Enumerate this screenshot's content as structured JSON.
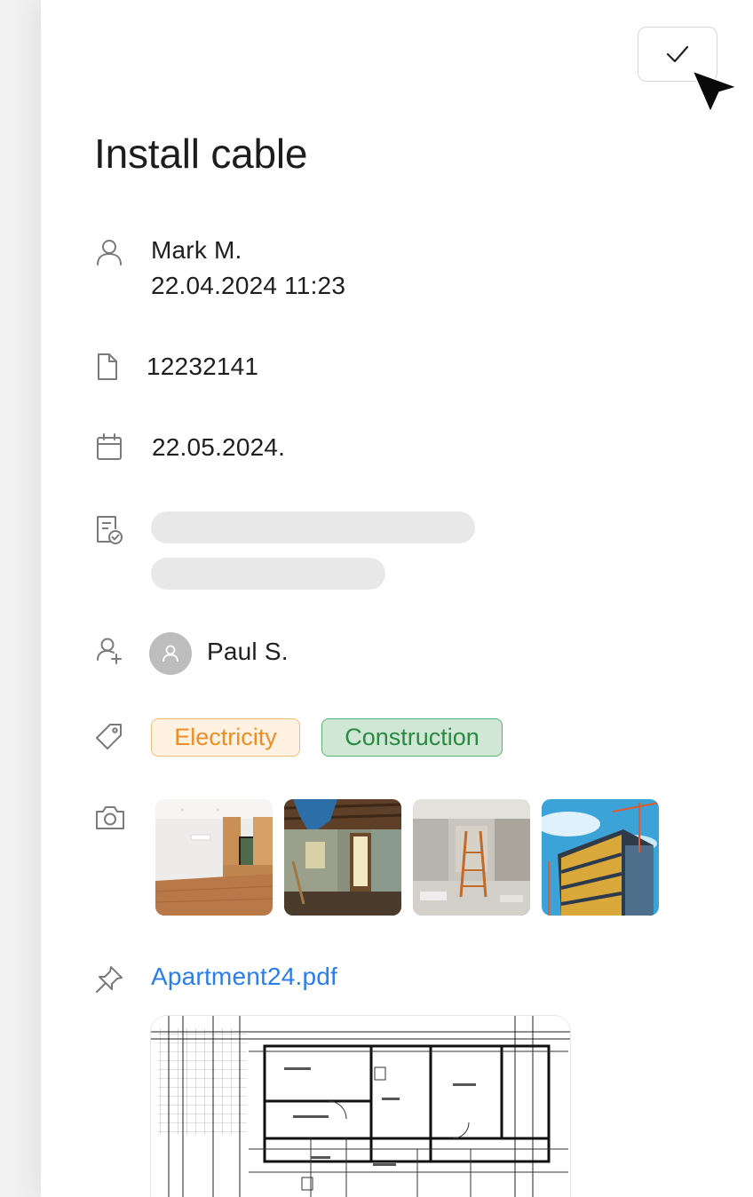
{
  "task": {
    "title": "Install cable",
    "creator": "Mark M.",
    "created_at": "22.04.2024 11:23",
    "number": "12232141",
    "due_date": "22.05.2024.",
    "assignee": "Paul S.",
    "tags": [
      {
        "label": "Electricity",
        "color": "#ef8c24",
        "bg": "#fff2e3"
      },
      {
        "label": "Construction",
        "color": "#2a8a3f",
        "bg": "#cfe7d4"
      }
    ],
    "photos": [
      "kitchen-interior",
      "gutted-room",
      "room-with-ladder",
      "building-facade"
    ],
    "attachment": "Apartment24.pdf"
  },
  "colors": {
    "link": "#2b7de9",
    "icon": "#7a7a7a",
    "skeleton": "#e8e8e8"
  }
}
